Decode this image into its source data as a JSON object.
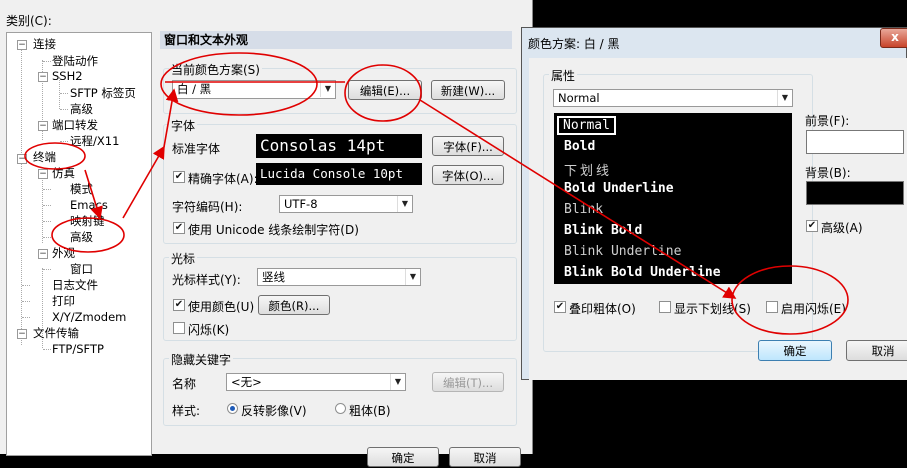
{
  "main": {
    "category_label": "类别(C):",
    "tree": [
      {
        "label": "连接"
      },
      {
        "label": "登陆动作"
      },
      {
        "label": "SSH2"
      },
      {
        "label": "SFTP 标签页"
      },
      {
        "label": "高级"
      },
      {
        "label": "端口转发"
      },
      {
        "label": "远程/X11"
      },
      {
        "label": "终端"
      },
      {
        "label": "仿真"
      },
      {
        "label": "模式"
      },
      {
        "label": "Emacs"
      },
      {
        "label": "映射键"
      },
      {
        "label": "高级"
      },
      {
        "label": "外观"
      },
      {
        "label": "窗口"
      },
      {
        "label": "日志文件"
      },
      {
        "label": "打印"
      },
      {
        "label": "X/Y/Zmodem"
      },
      {
        "label": "文件传输"
      },
      {
        "label": "FTP/SFTP"
      }
    ],
    "section_title": "窗口和文本外观",
    "scheme": {
      "group_label": "当前颜色方案(S)",
      "value": "白 / 黑",
      "edit_button": "编辑(E)...",
      "new_button": "新建(W)..."
    },
    "fonts": {
      "group_label": "字体",
      "standard_label": "标准字体",
      "standard_value": "Consolas 14pt",
      "standard_button": "字体(F)...",
      "precise_label": "精确字体(A):",
      "precise_checked": true,
      "precise_value": "Lucida Console 10pt",
      "precise_button": "字体(O)...",
      "encoding_label": "字符编码(H):",
      "encoding_value": "UTF-8",
      "unicode_label": "使用 Unicode 线条绘制字符(D)",
      "unicode_checked": true
    },
    "cursor": {
      "group_label": "光标",
      "style_label": "光标样式(Y):",
      "style_value": "竖线",
      "use_color_label": "使用颜色(U)",
      "use_color_checked": true,
      "color_button": "颜色(R)...",
      "blink_label": "闪烁(K)",
      "blink_checked": false
    },
    "hidden_keyword": {
      "group_label": "隐藏关键字",
      "name_label": "名称",
      "name_value": "<无>",
      "edit_button": "编辑(T)...",
      "style_label": "样式:",
      "reverse_label": "反转影像(V)",
      "bold_label": "粗体(B)"
    },
    "ok_button": "确定",
    "cancel_button": "取消"
  },
  "dialog": {
    "title": "颜色方案: 白 / 黑",
    "close_glyph": "x",
    "attributes_label": "属性",
    "attribute_value": "Normal",
    "preview_lines": [
      "Normal",
      "Bold",
      "下划线",
      "Bold Underline",
      "Blink",
      "Blink Bold",
      "Blink Underline",
      "Blink Bold Underline"
    ],
    "foreground_label": "前景(F):",
    "background_label": "背景(B):",
    "foreground_color": "#ffffff",
    "background_color": "#000000",
    "highlight_label": "高级(A)",
    "highlight_checked": true,
    "overprint_bold_label": "叠印粗体(O)",
    "overprint_bold_checked": true,
    "show_underline_label": "显示下划线(S)",
    "show_underline_checked": false,
    "enable_blink_label": "启用闪烁(E)",
    "enable_blink_checked": false,
    "ok_button": "确定",
    "cancel_button": "取消"
  },
  "colors": {
    "annotation_red": "#e00000",
    "section_header_bg": "#d6dde8",
    "dialog_frame": "#dce6f0",
    "terminal_bg": "#000000"
  }
}
